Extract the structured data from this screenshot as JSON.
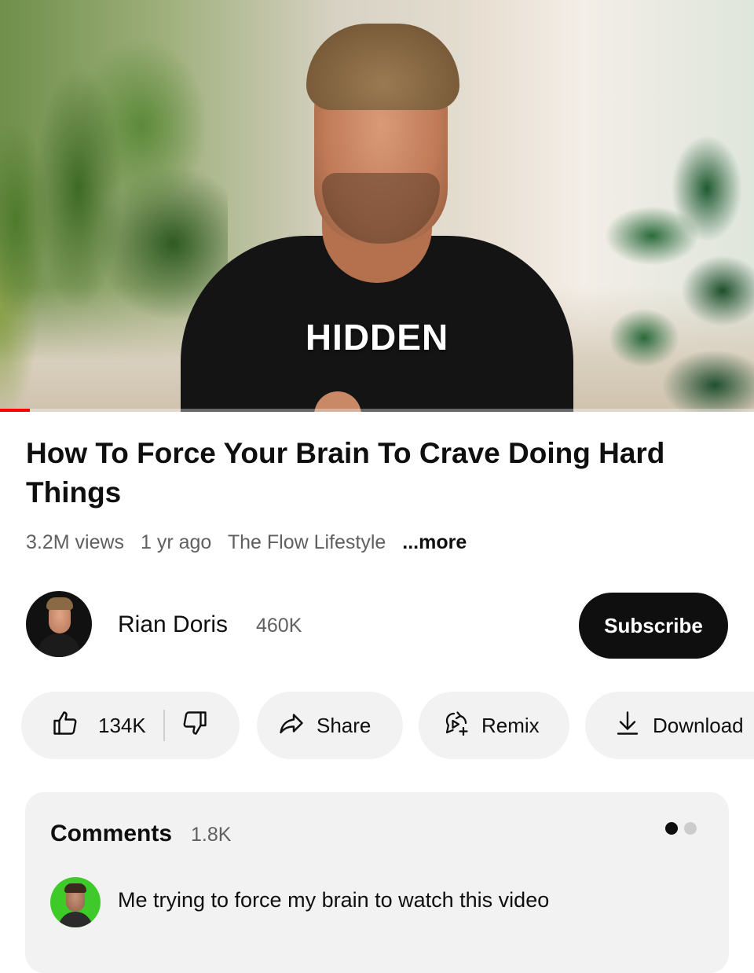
{
  "video": {
    "caption": "HIDDEN",
    "progress_fraction": 0.04,
    "progress_color": "#ff0000"
  },
  "title": "How To Force Your Brain To Crave Doing Hard Things",
  "meta": {
    "views": "3.2M views",
    "age": "1 yr ago",
    "channel_tag": "The Flow Lifestyle",
    "more": "...more"
  },
  "channel": {
    "name": "Rian Doris",
    "subscribers": "460K",
    "subscribe_label": "Subscribe"
  },
  "actions": {
    "like_count": "134K",
    "like_icon": "thumbs-up-icon",
    "dislike_icon": "thumbs-down-icon",
    "share_label": "Share",
    "share_icon": "share-arrow-icon",
    "remix_label": "Remix",
    "remix_icon": "remix-icon",
    "download_label": "Download",
    "download_icon": "download-icon"
  },
  "comments": {
    "heading": "Comments",
    "count": "1.8K",
    "top_comment": "Me trying to force my brain to watch this video",
    "pagination_active": 1,
    "pagination_total": 2
  },
  "colors": {
    "subscribe_bg": "#0f0f0f",
    "pill_bg": "#f2f2f2",
    "comment_avatar_bg": "#3ecb2a"
  }
}
